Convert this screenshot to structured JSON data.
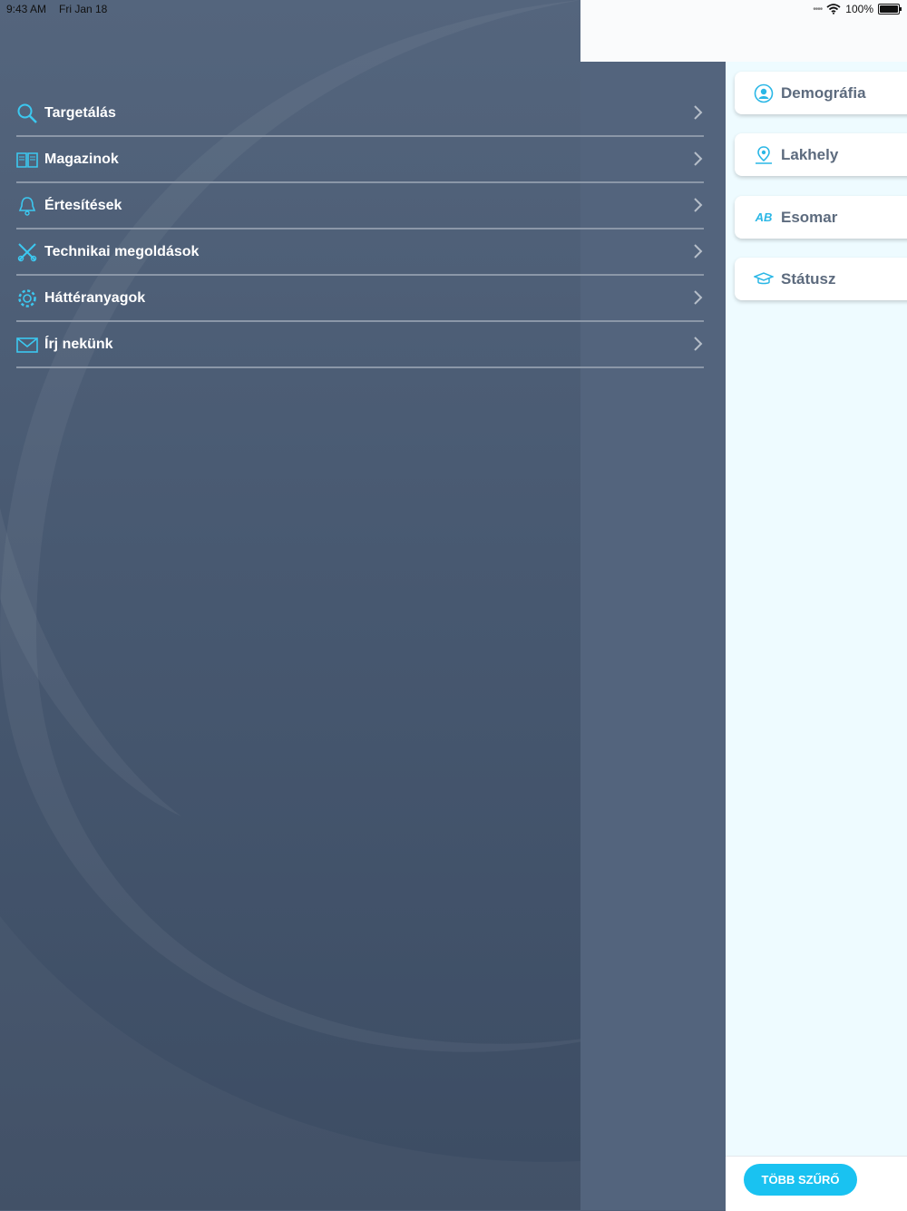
{
  "status_bar": {
    "time": "9:43 AM",
    "date": "Fri Jan 18",
    "battery": "100%"
  },
  "menu": {
    "items": [
      {
        "label": "Targetálás",
        "icon": "search-icon"
      },
      {
        "label": "Magazinok",
        "icon": "book-icon"
      },
      {
        "label": "Értesítések",
        "icon": "bell-icon"
      },
      {
        "label": "Technikai megoldások",
        "icon": "tools-icon"
      },
      {
        "label": "Háttéranyagok",
        "icon": "gear-icon"
      },
      {
        "label": "Írj nekünk",
        "icon": "envelope-icon"
      }
    ]
  },
  "filters": {
    "items": [
      {
        "label": "Demográfia",
        "icon": "person-icon"
      },
      {
        "label": "Lakhely",
        "icon": "location-icon"
      },
      {
        "label": "Esomar",
        "icon": "ab-icon",
        "icon_text": "AB"
      },
      {
        "label": "Státusz",
        "icon": "graduation-cap-icon"
      }
    ],
    "more_button": "TÖBB SZŰRŐ"
  },
  "colors": {
    "accent": "#19c2f1",
    "menu_bg": "#4a5b73",
    "icon": "#3cc8f0"
  }
}
